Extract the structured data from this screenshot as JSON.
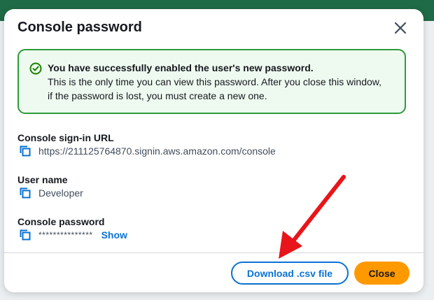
{
  "modal": {
    "title": "Console password",
    "alert": {
      "title": "You have successfully enabled the user's new password.",
      "line1": "This is the only time you can view this password. After you close this window,",
      "line2": "if the password is lost, you must create a new one."
    },
    "fields": {
      "url_label": "Console sign-in URL",
      "url_value": "https://211125764870.signin.aws.amazon.com/console",
      "username_label": "User name",
      "username_value": "Developer",
      "password_label": "Console password",
      "password_value": "***************",
      "show_label": "Show"
    },
    "buttons": {
      "download_label": "Download .csv file",
      "close_label": "Close"
    }
  },
  "colors": {
    "primary_link": "#0972d3",
    "close_button": "#ff9900",
    "success_border": "#2e9a3c",
    "annotation_arrow": "#e8151b"
  },
  "icons": [
    "close-icon",
    "success-check-icon",
    "copy-icon",
    "annotation-arrow"
  ]
}
